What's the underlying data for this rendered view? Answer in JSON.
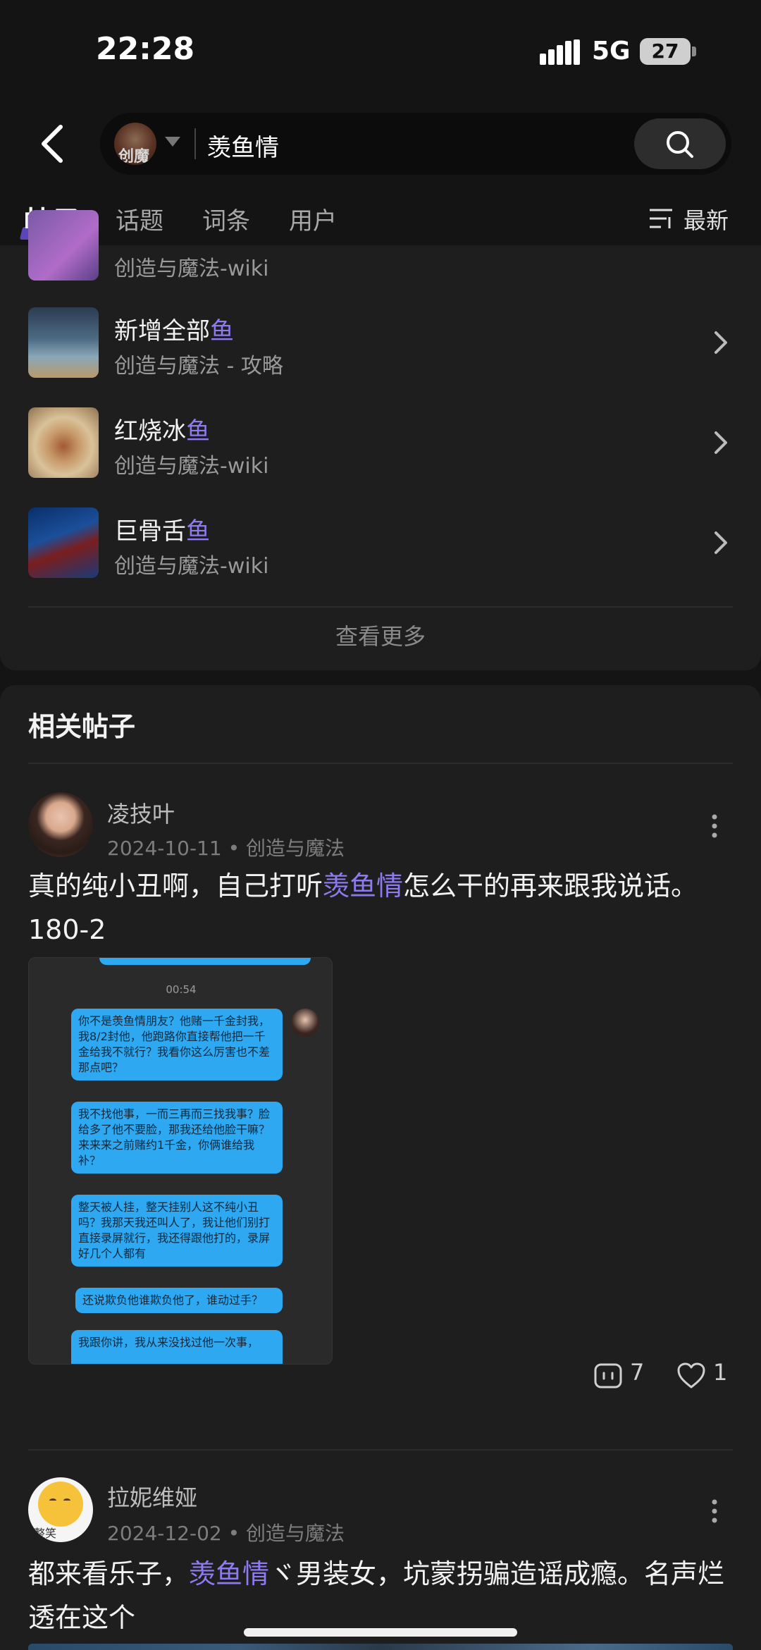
{
  "status_bar": {
    "time": "22:28",
    "network": "5G",
    "battery": "27"
  },
  "search": {
    "query": "羡鱼情"
  },
  "tabs": [
    {
      "label": "帖子"
    },
    {
      "label": "话题"
    },
    {
      "label": "词条"
    },
    {
      "label": "用户"
    }
  ],
  "sort_label": "最新",
  "wiki_list": {
    "partial_item_subtitle": "创造与魔法-wiki",
    "items": [
      {
        "title_prefix": "新增全部",
        "title_highlight": "鱼",
        "subtitle": "创造与魔法 - 攻略"
      },
      {
        "title_prefix": "红烧冰",
        "title_highlight": "鱼",
        "subtitle": "创造与魔法-wiki"
      },
      {
        "title_prefix": "巨骨舌",
        "title_highlight": "鱼",
        "subtitle": "创造与魔法-wiki"
      }
    ],
    "more_label": "查看更多"
  },
  "related": {
    "title": "相关帖子",
    "posts": [
      {
        "author": "凌技叶",
        "meta": "2024-10-11 • 创造与魔法",
        "text_before": "真的纯小丑啊，自己打听",
        "text_highlight": "羡鱼情",
        "text_after": "怎么干的再来跟我说话。180-2",
        "comments": "7",
        "likes": "1",
        "screenshot": {
          "time": "00:54",
          "bubbles": [
            "你不是羡鱼情朋友？他赌一千金封我，我8/2封他，他跑路你直接帮他把一千金给我不就行？我看你这么厉害也不差那点吧？",
            "我不找他事，一而三再而三找我事？脸给多了他不要脸，那我还给他脸干嘛？来来来之前赌约1千金，你俩谁给我补？",
            "整天被人挂，整天挂别人这不纯小丑吗？我那天我还叫人了，我让他们别打直接录屏就行，我还得跟他打的，录屏好几个人都有",
            "还说欺负他谁欺负他了，谁动过手？",
            "我跟你讲，我从来没找过他一次事，"
          ]
        }
      },
      {
        "author": "拉妮维娅",
        "meta": "2024-12-02 • 创造与魔法",
        "avatar_text": "整笑",
        "text_before": "都来看乐子，",
        "text_highlight": "羡鱼情",
        "text_after": "ヾ男装女，坑蒙拐骗造谣成瘾。名声烂透在这个"
      }
    ]
  }
}
